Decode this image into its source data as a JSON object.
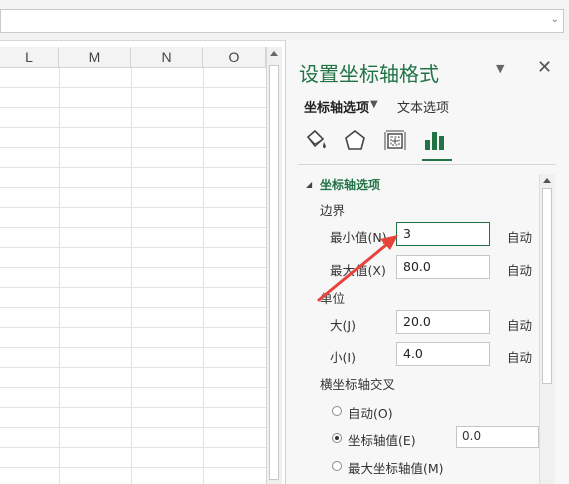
{
  "columns": [
    "L",
    "M",
    "N",
    "O"
  ],
  "pane": {
    "title": "设置坐标轴格式",
    "menu_icon": "chevron-down",
    "close_icon": "close",
    "tabs": {
      "options_label": "坐标轴选项",
      "text_label": "文本选项"
    },
    "icons": [
      "fill-line-icon",
      "effects-icon",
      "size-properties-icon",
      "axis-options-icon"
    ],
    "accent_color": "#217346",
    "section": {
      "title": "坐标轴选项",
      "bounds": {
        "label": "边界",
        "min": {
          "label": "最小值(N)",
          "value": "3",
          "auto": "自动"
        },
        "max": {
          "label": "最大值(X)",
          "value": "80.0",
          "auto": "自动"
        }
      },
      "units": {
        "label": "单位",
        "major": {
          "label": "大(J)",
          "value": "20.0",
          "auto": "自动"
        },
        "minor": {
          "label": "小(I)",
          "value": "4.0",
          "auto": "自动"
        }
      },
      "cross": {
        "label": "横坐标轴交叉",
        "options": [
          {
            "label": "自动(O)",
            "checked": false
          },
          {
            "label": "坐标轴值(E)",
            "checked": true
          },
          {
            "label": "最大坐标轴值(M)",
            "checked": false
          }
        ],
        "axis_value": "0.0"
      }
    }
  },
  "annotation_color": "#e8433a"
}
